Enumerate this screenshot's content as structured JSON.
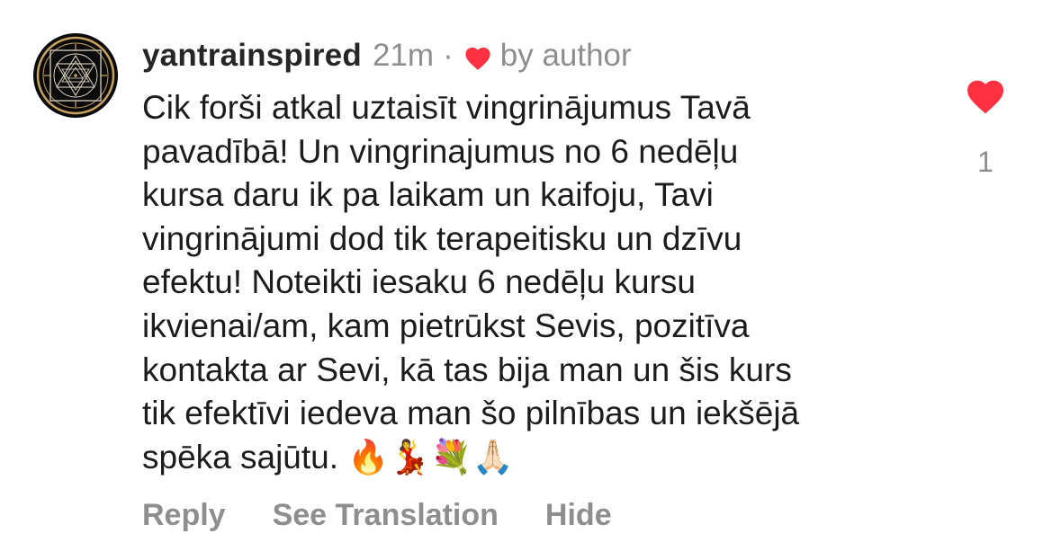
{
  "comment": {
    "username": "yantrainspired",
    "time": "21m",
    "separator": "·",
    "liked_by_author_label": "by author",
    "text": "Cik forši atkal uztaisīt vingrinājumus Tavā\npavadībā! Un vingrinajumus no 6 nedēļu\nkursa daru ik pa laikam un kaifoju, Tavi\nvingrinājumi dod tik terapeitisku un dzīvu\nefektu! Noteikti iesaku 6 nedēļu kursu\nikvienai/am, kam pietrūkst Sevis, pozitīva\nkontakta ar Sevi, kā tas bija man un šis kurs\ntik efektīvi iedeva man šo pilnības un iekšējā\nspēka sajūtu. 🔥💃💐🙏🏻",
    "like_count": "1",
    "actions": {
      "reply": "Reply",
      "see_translation": "See Translation",
      "hide": "Hide"
    }
  },
  "icons": {
    "avatar": "sri-yantra-logo",
    "author_heart": "heart-icon",
    "like": "heart-icon"
  },
  "colors": {
    "heart_red": "#ff3040",
    "secondary_text": "#8e8e8e",
    "primary_text": "#1c1c1e",
    "avatar_gold": "#c9a35b"
  }
}
